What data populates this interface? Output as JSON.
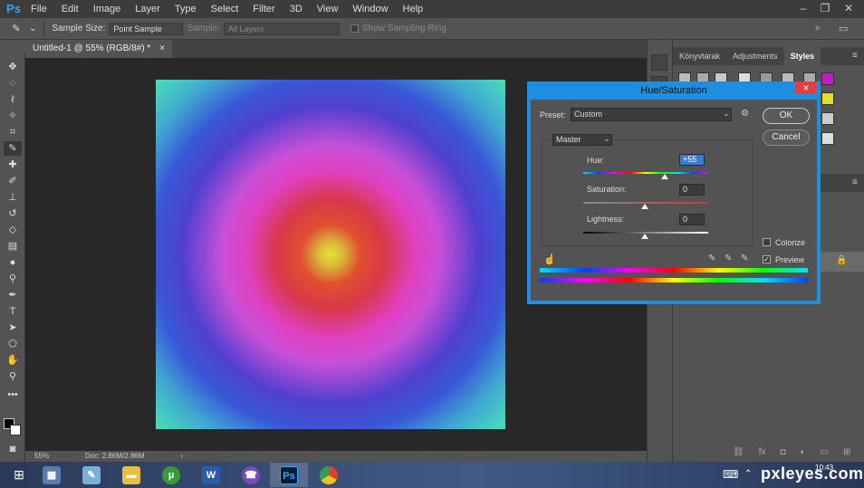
{
  "app": {
    "logo": "Ps",
    "menu": [
      "File",
      "Edit",
      "Image",
      "Layer",
      "Type",
      "Select",
      "Filter",
      "3D",
      "View",
      "Window",
      "Help"
    ]
  },
  "options_bar": {
    "sample_size_label": "Sample Size:",
    "sample_size_value": "Point Sample",
    "sample_label": "Sample:",
    "sample_value": "All Layers",
    "show_ring_label": "Show Sampling Ring"
  },
  "document": {
    "tab_title": "Untitled-1 @ 55% (RGB/8#) *",
    "tab_close": "×",
    "zoom": "55%",
    "doc_size": "Doc: 2.86M/2.86M"
  },
  "panels": {
    "tabs": [
      "Könyvtárak",
      "Adjustments",
      "Styles"
    ],
    "active_tab": "Styles"
  },
  "dialog": {
    "title": "Hue/Saturation",
    "close": "×",
    "preset_label": "Preset:",
    "preset_value": "Custom",
    "channel_value": "Master",
    "hue_label": "Hue:",
    "hue_value": "+55",
    "hue_level": 55,
    "saturation_label": "Saturation:",
    "saturation_value": "0",
    "lightness_label": "Lightness:",
    "lightness_value": "0",
    "ok_label": "OK",
    "cancel_label": "Cancel",
    "colorize_label": "Colorize",
    "colorize_checked": false,
    "preview_label": "Preview",
    "preview_checked": true
  },
  "taskbar": {
    "watermark": "pxleyes.com",
    "time": "10:43"
  },
  "colors": {
    "dialog_frame": "#1e8fe0",
    "accent": "#31a8ff",
    "close_red": "#e04040"
  }
}
